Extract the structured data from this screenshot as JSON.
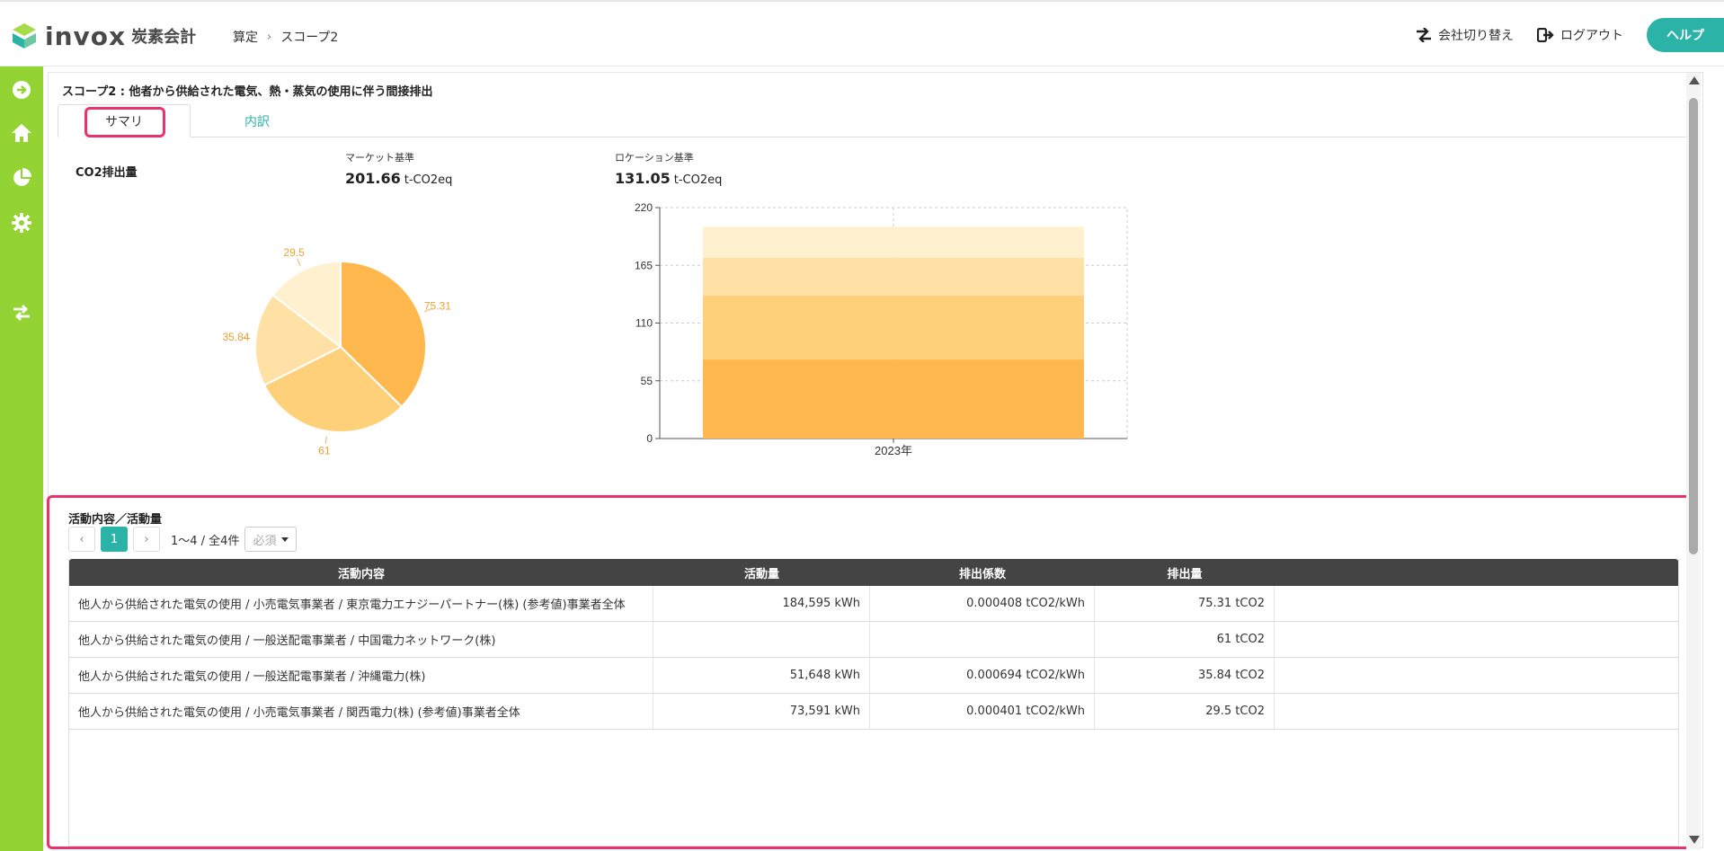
{
  "header": {
    "logo_text": "invox",
    "logo_sub": "炭素会計",
    "breadcrumb": [
      "算定",
      "スコープ2"
    ],
    "switch_company": "会社切り替え",
    "logout": "ログアウト",
    "help": "ヘルプ"
  },
  "page": {
    "title": "スコープ2 : 他者から供給された電気、熱・蒸気の使用に伴う間接排出",
    "tabs": [
      "サマリ",
      "内訳"
    ],
    "co2_label": "CO2排出量"
  },
  "metrics": {
    "market": {
      "label": "マーケット基準",
      "value": "201.66",
      "unit": "t-CO2eq"
    },
    "location": {
      "label": "ロケーション基準",
      "value": "131.05",
      "unit": "t-CO2eq"
    }
  },
  "chart_data": [
    {
      "type": "pie",
      "labels": [
        "75.31",
        "61",
        "35.84",
        "29.5"
      ],
      "values": [
        75.31,
        61,
        35.84,
        29.5
      ],
      "colors": [
        "#ffb84d",
        "#ffd07a",
        "#ffe1a6",
        "#fff0cf"
      ]
    },
    {
      "type": "bar",
      "stacked": true,
      "categories": [
        "2023年"
      ],
      "series": [
        {
          "values": [
            75.31
          ],
          "color": "#ffb84d"
        },
        {
          "values": [
            61
          ],
          "color": "#ffd07a"
        },
        {
          "values": [
            35.84
          ],
          "color": "#ffe1a6"
        },
        {
          "values": [
            29.5
          ],
          "color": "#fff0cf"
        }
      ],
      "ylim": [
        0,
        220
      ],
      "yticks": [
        "0",
        "55",
        "110",
        "165",
        "220"
      ],
      "grid": true
    }
  ],
  "activity": {
    "title": "活動内容／活動量",
    "page": "1",
    "range_text": "1〜4 / 全4件",
    "filter_placeholder": "必須",
    "columns": [
      "活動内容",
      "活動量",
      "排出係数",
      "排出量"
    ],
    "rows": [
      {
        "content": "他人から供給された電気の使用 / 小売電気事業者 / 東京電力エナジーパートナー(株) (参考値)事業者全体",
        "amount": "184,595 kWh",
        "factor": "0.000408 tCO2/kWh",
        "emission": "75.31 tCO2"
      },
      {
        "content": "他人から供給された電気の使用 / 一般送配電事業者 / 中国電力ネットワーク(株)",
        "amount": "",
        "factor": "",
        "emission": "61 tCO2"
      },
      {
        "content": "他人から供給された電気の使用 / 一般送配電事業者 / 沖縄電力(株)",
        "amount": "51,648 kWh",
        "factor": "0.000694 tCO2/kWh",
        "emission": "35.84 tCO2"
      },
      {
        "content": "他人から供給された電気の使用 / 小売電気事業者 / 関西電力(株) (参考値)事業者全体",
        "amount": "73,591 kWh",
        "factor": "0.000401 tCO2/kWh",
        "emission": "29.5 tCO2"
      }
    ]
  },
  "colors": {
    "accent": "#2bb3a7",
    "sidebar": "#93d434",
    "highlight": "#e8336d",
    "table_header": "#444444"
  }
}
